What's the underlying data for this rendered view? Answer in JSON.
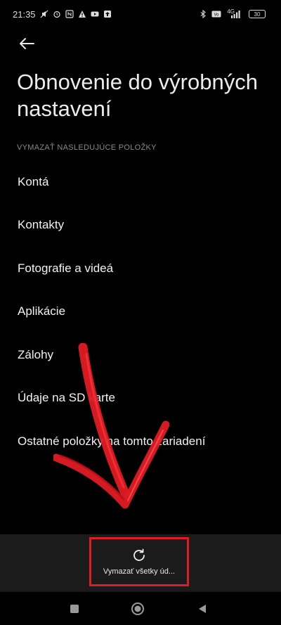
{
  "status_bar": {
    "time": "21:35",
    "left_icons": [
      "mute-icon",
      "alarm-icon",
      "nfc-icon",
      "warning-icon",
      "youtube-icon",
      "upload-icon"
    ],
    "right_icons": [
      "bluetooth-icon",
      "volte-icon",
      "signal-4g-icon"
    ],
    "network": "4G",
    "battery": "30"
  },
  "header": {
    "back_icon": "arrow-left-icon",
    "title": "Obnovenie do výrobných nastavení"
  },
  "section": {
    "label": "VYMAZAŤ NASLEDUJÚCE POLOŽKY"
  },
  "items": [
    {
      "label": "Kontá"
    },
    {
      "label": "Kontakty"
    },
    {
      "label": "Fotografie a videá"
    },
    {
      "label": "Aplikácie"
    },
    {
      "label": "Zálohy"
    },
    {
      "label": "Údaje na SD karte"
    },
    {
      "label": "Ostatné položky na tomto zariadení"
    }
  ],
  "annotation": {
    "arrow_color": "#e11b23"
  },
  "bottom": {
    "erase_icon": "refresh-icon",
    "erase_label": "Vymazať všetky úd..."
  },
  "nav": {
    "recents_icon": "square-icon",
    "home_icon": "circle-icon",
    "back_icon": "triangle-back-icon"
  }
}
